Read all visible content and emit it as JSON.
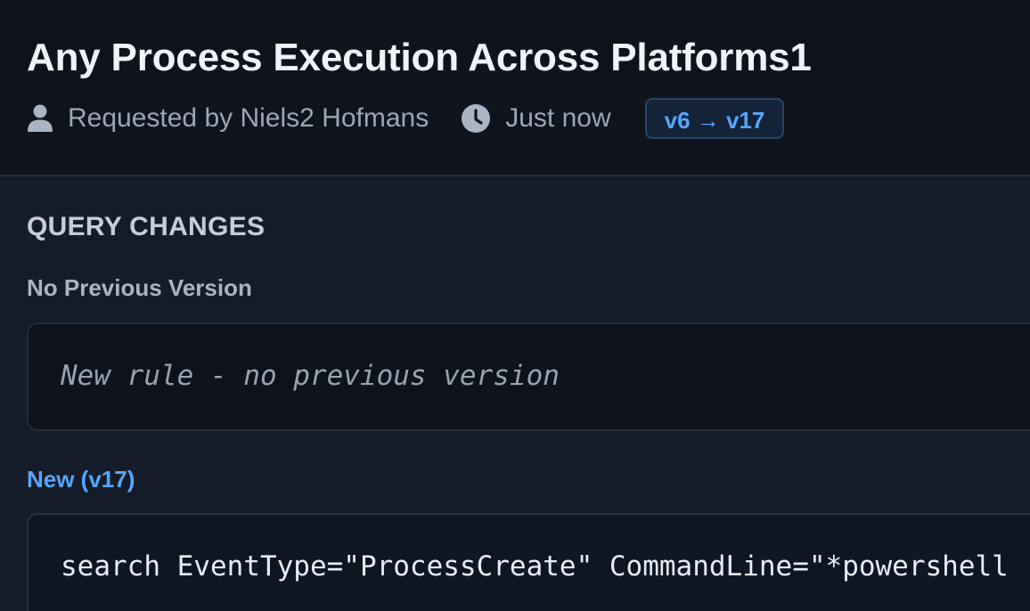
{
  "header": {
    "title": "Any Process Execution Across Platforms1",
    "requested_by": "Requested by Niels2 Hofmans",
    "time": "Just now",
    "version_badge": "v6 → v17",
    "icons": {
      "user": "user-icon",
      "time": "clock-icon"
    }
  },
  "changes": {
    "heading": "QUERY CHANGES",
    "previous": {
      "label": "No Previous Version",
      "text": "New rule - no previous version"
    },
    "new": {
      "label": "New (v17)",
      "query": "search EventType=\"ProcessCreate\" CommandLine=\"*powershell"
    }
  },
  "colors": {
    "accent": "#58a6ff",
    "header_bg": "#0e131c",
    "page_bg": "#151c29",
    "badge_bg": "#142338"
  }
}
